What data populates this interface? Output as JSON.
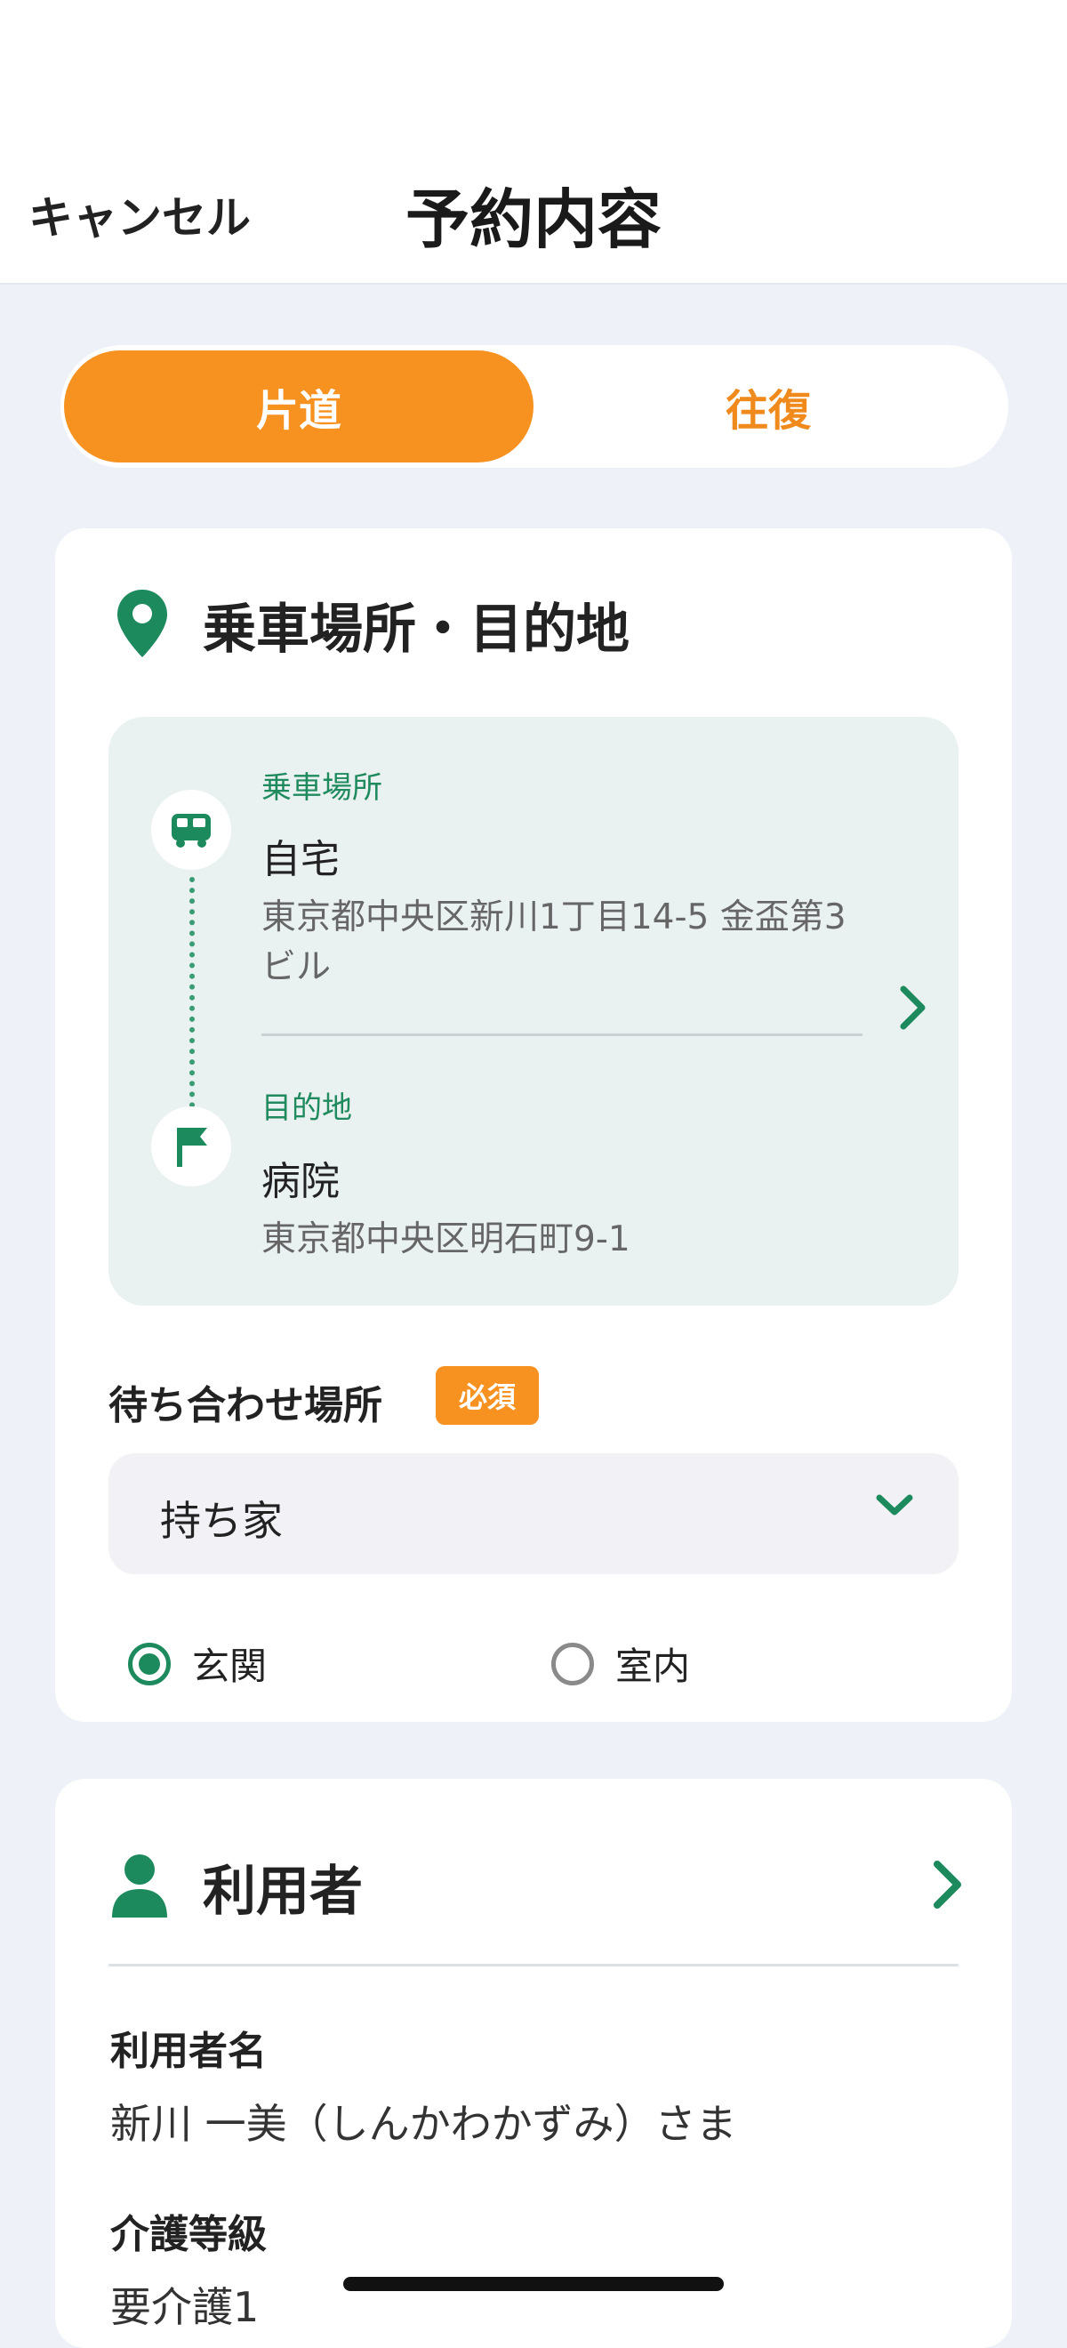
{
  "header": {
    "cancel_label": "キャンセル",
    "title": "予約内容"
  },
  "segment": {
    "one_way": "片道",
    "round_trip": "往復",
    "selected": "片道"
  },
  "route_section": {
    "title": "乗車場所・目的地",
    "pickup": {
      "label": "乗車場所",
      "name": "自宅",
      "address": "東京都中央区新川1丁目14-5 金盃第3ビル",
      "icon": "car-icon"
    },
    "destination": {
      "label": "目的地",
      "name": "病院",
      "address": "東京都中央区明石町9-1",
      "icon": "flag-icon"
    }
  },
  "meeting_place": {
    "label": "待ち合わせ場所",
    "required_badge": "必須",
    "selected_value": "持ち家",
    "options": [
      {
        "label": "玄関",
        "checked": true
      },
      {
        "label": "室内",
        "checked": false
      }
    ]
  },
  "user_section": {
    "title": "利用者",
    "name_label": "利用者名",
    "name_value": "新川 一美（しんかわかずみ）さま",
    "care_level_label": "介護等級",
    "care_level_value": "要介護1"
  },
  "colors": {
    "accent_orange": "#f7911f",
    "accent_green": "#1c8a5d",
    "background": "#eef1f8"
  }
}
